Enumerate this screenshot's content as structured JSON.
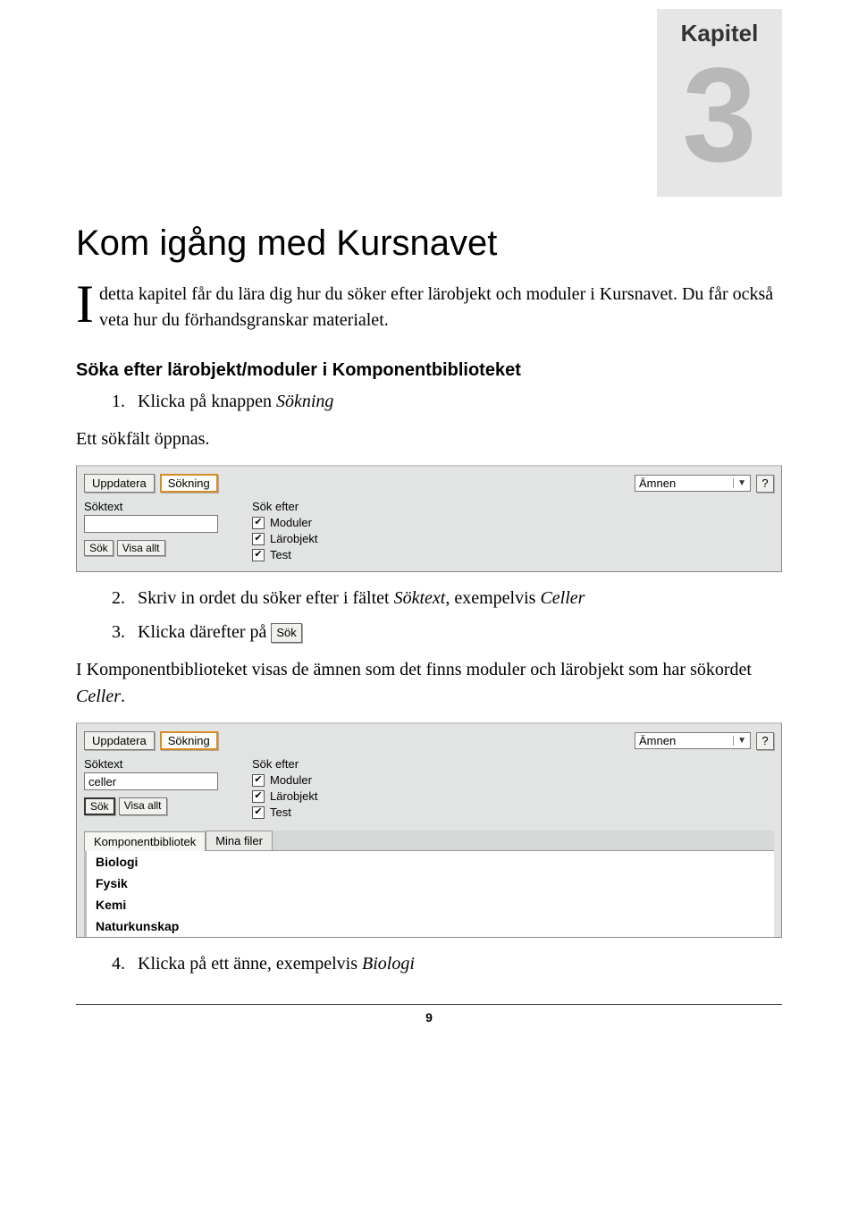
{
  "chapter": {
    "label": "Kapitel",
    "number": "3"
  },
  "title": "Kom igång med Kursnavet",
  "intro": {
    "dropcap": "I",
    "text": " detta kapitel får du lära dig hur du söker efter lärobjekt och moduler i Kursnavet. Du får också veta hur du förhandsgranskar materialet."
  },
  "section1_head": "Söka efter lärobjekt/moduler i Komponentbiblioteket",
  "steps": {
    "s1_num": "1.",
    "s1_a": "Klicka på knappen ",
    "s1_b": "Sökning",
    "after_s1": "Ett sökfält öppnas.",
    "s2_num": "2.",
    "s2_a": "Skriv in ordet du söker efter i fältet ",
    "s2_b": "Söktext",
    "s2_c": ", exempelvis ",
    "s2_d": "Celler",
    "s3_num": "3.",
    "s3_a": "Klicka därefter på ",
    "after_s3_a": "I Komponentbiblioteket visas de ämnen som det finns moduler och lärobjekt som har sökordet ",
    "after_s3_b": "Celler",
    "after_s3_c": ".",
    "s4_num": "4.",
    "s4_a": "Klicka på ett änne, exempelvis ",
    "s4_b": "Biologi"
  },
  "ui": {
    "btn_uppdatera": "Uppdatera",
    "btn_sokning": "Sökning",
    "select_amnen": "Ämnen",
    "help": "?",
    "lbl_soktext": "Söktext",
    "lbl_sokefter": "Sök efter",
    "chk_moduler": "Moduler",
    "chk_larobjekt": "Lärobjekt",
    "chk_test": "Test",
    "btn_sok": "Sök",
    "btn_visaallt": "Visa allt",
    "input_empty": "",
    "input_celler": "celler",
    "tab_komponent": "Komponentbibliotek",
    "tab_minafiler": "Mina filer",
    "subjects": [
      "Biologi",
      "Fysik",
      "Kemi",
      "Naturkunskap"
    ],
    "inline_sok": "Sök"
  },
  "page_number": "9"
}
